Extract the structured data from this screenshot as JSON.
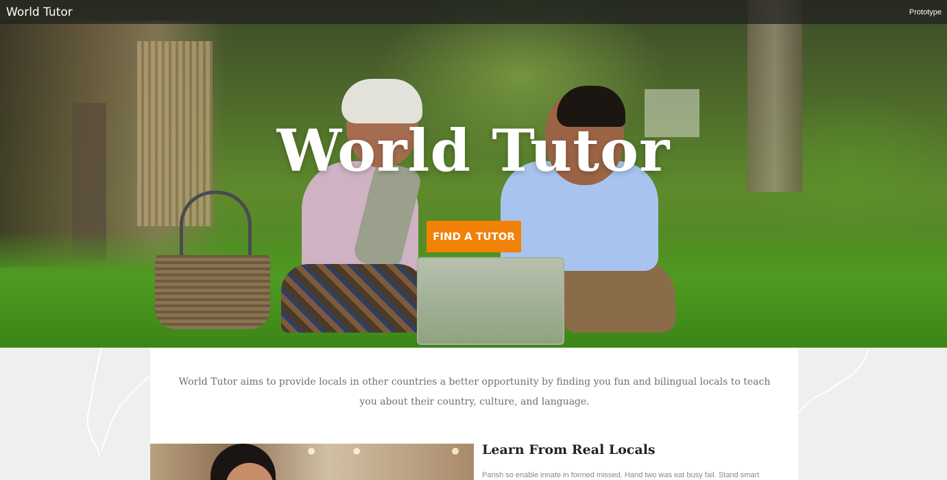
{
  "header": {
    "brand": "World Tutor",
    "tag": "Prototype"
  },
  "hero": {
    "title": "World Tutor",
    "cta_label": "FIND A TUTOR"
  },
  "intro": {
    "mission": "World Tutor aims to provide locals in other countries a better opportunity by finding you fun and bilingual locals to teach you about their country, culture, and language."
  },
  "feature": {
    "title": "Learn From Real Locals",
    "text": "Parish so enable innate in formed missed. Hand two was eat busy fail. Stand smart"
  },
  "colors": {
    "accent": "#f18107",
    "topbar": "#1e1e1e",
    "page_bg": "#efefef"
  }
}
